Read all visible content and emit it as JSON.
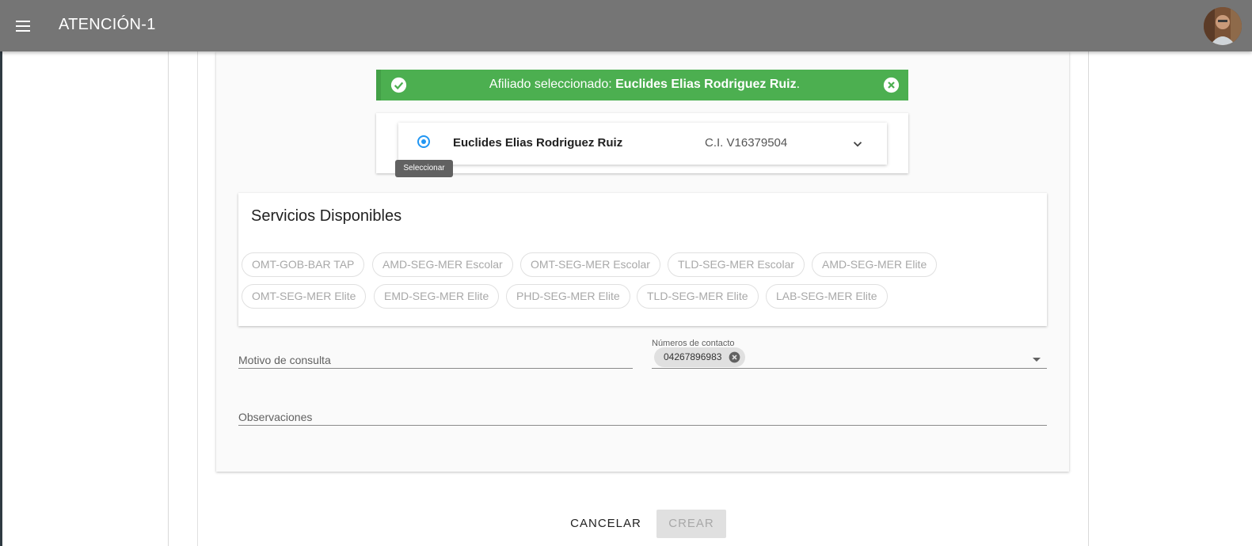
{
  "app": {
    "title": "ATENCIÓN-1"
  },
  "alert": {
    "prefix": "Afiliado seleccionado: ",
    "name": "Euclides Elias Rodriguez Ruiz",
    "suffix": ".",
    "color": "#4caf50"
  },
  "affiliate": {
    "name": "Euclides Elias Rodriguez Ruiz",
    "ci": "C.I. V16379504",
    "tooltip": "Seleccionar",
    "selected": true
  },
  "services": {
    "title": "Servicios Disponibles",
    "chips": [
      "OMT-GOB-BAR TAP",
      "AMD-SEG-MER Escolar",
      "OMT-SEG-MER Escolar",
      "TLD-SEG-MER Escolar",
      "AMD-SEG-MER Elite",
      "OMT-SEG-MER Elite",
      "EMD-SEG-MER Elite",
      "PHD-SEG-MER Elite",
      "TLD-SEG-MER Elite",
      "LAB-SEG-MER Elite"
    ]
  },
  "form": {
    "motivo_label": "Motivo de consulta",
    "contact_label": "Números de contacto",
    "contact_values": [
      "04267896983"
    ],
    "observaciones_label": "Observaciones"
  },
  "actions": {
    "cancel_label": "CANCELAR",
    "create_label": "CREAR"
  },
  "colors": {
    "appbar": "#757575",
    "accent": "#2196f3",
    "success": "#4caf50"
  }
}
